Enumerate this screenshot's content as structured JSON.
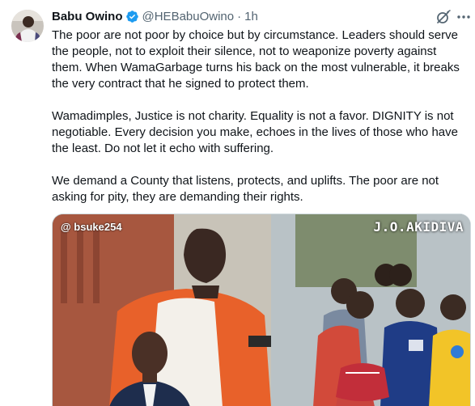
{
  "author": {
    "display_name": "Babu Owino",
    "handle": "@HEBabuOwino",
    "separator": "·",
    "time": "1h"
  },
  "icons": {
    "verified": "verified-badge-icon",
    "grok": "grok-icon",
    "more": "more-options-icon"
  },
  "colors": {
    "verified": "#1d9bf0",
    "secondary_text": "#536471"
  },
  "tweet": {
    "paragraphs": [
      "The poor are not poor by choice but by circumstance. Leaders should serve the people, not to exploit their silence, not to weaponize poverty against them. When WamaGarbage turns his back on the most vulnerable, it breaks the very contract that he signed to protect them.",
      "Wamadimples, Justice is not charity. Equality is not a favor. DIGNITY is not negotiable. Every decision you make, echoes in the lives of those who have the least. Do not let it echo with suffering.",
      "We demand a County that listens, protects, and uplifts. The poor are not asking for pity, they are demanding their rights."
    ]
  },
  "media": {
    "watermark_left": "@ bsuke254",
    "watermark_right": "J.O.AKIDIVA"
  }
}
